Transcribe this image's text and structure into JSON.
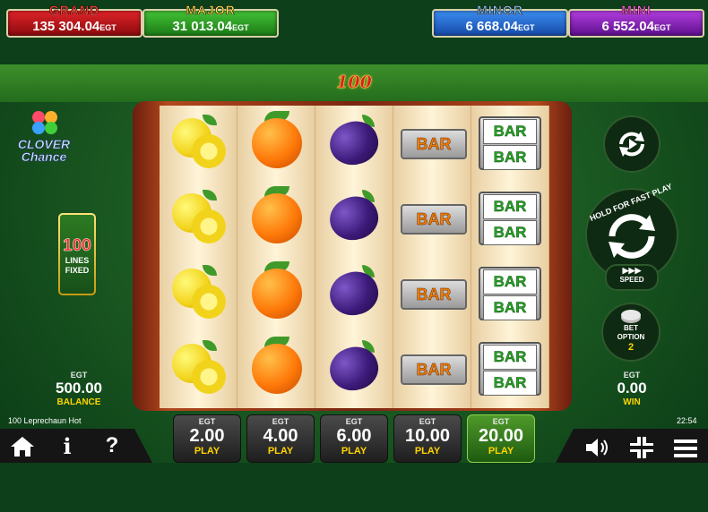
{
  "jackpots": [
    {
      "name": "GRAND",
      "value": "135 304.04",
      "currency": "EGT"
    },
    {
      "name": "MAJOR",
      "value": "31 013.04",
      "currency": "EGT"
    },
    {
      "name": "MINOR",
      "value": "6 668.04",
      "currency": "EGT"
    },
    {
      "name": "MINI",
      "value": "6 552.04",
      "currency": "EGT"
    }
  ],
  "game_logo": "100 Leprechaun Hot",
  "side_logo": {
    "line1": "CLOVER",
    "line2": "Chance"
  },
  "lines": {
    "count": "100",
    "label1": "LINES",
    "label2": "FIXED"
  },
  "balance": {
    "currency": "EGT",
    "value": "500.00",
    "label": "BALANCE"
  },
  "win": {
    "currency": "EGT",
    "value": "0.00",
    "label": "WIN"
  },
  "spin": {
    "hold_text": "HOLD FOR FAST PLAY"
  },
  "speed": {
    "icon": "▶▶▶",
    "label": "SPEED"
  },
  "bet_option": {
    "label1": "BET",
    "label2": "OPTION",
    "value": "2"
  },
  "reels": [
    [
      "lemon",
      "lemon",
      "lemon",
      "lemon"
    ],
    [
      "orange",
      "orange",
      "orange",
      "orange"
    ],
    [
      "plum",
      "plum",
      "plum",
      "plum"
    ],
    [
      "bar",
      "bar",
      "bar",
      "bar"
    ],
    [
      "double-bar",
      "double-bar",
      "double-bar",
      "double-bar"
    ]
  ],
  "symbol_text": {
    "bar": "BAR"
  },
  "footer": {
    "title": "100 Leprechaun Hot",
    "clock": "22:54"
  },
  "bets": [
    {
      "currency": "EGT",
      "value": "2.00",
      "label": "PLAY",
      "active": false
    },
    {
      "currency": "EGT",
      "value": "4.00",
      "label": "PLAY",
      "active": false
    },
    {
      "currency": "EGT",
      "value": "6.00",
      "label": "PLAY",
      "active": false
    },
    {
      "currency": "EGT",
      "value": "10.00",
      "label": "PLAY",
      "active": false
    },
    {
      "currency": "EGT",
      "value": "20.00",
      "label": "PLAY",
      "active": true
    }
  ],
  "bottom_icons": {
    "home": "home-icon",
    "info": "i",
    "help": "?",
    "sound": "speaker-icon",
    "fullscreen": "collapse-icon",
    "menu": "menu-icon"
  }
}
